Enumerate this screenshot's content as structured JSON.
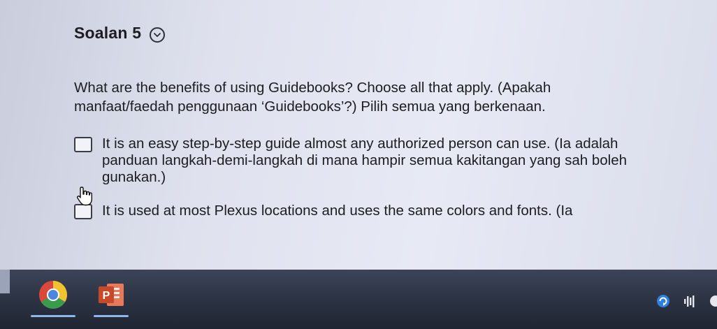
{
  "question": {
    "title": "Soalan 5",
    "prompt": "What are the benefits of using Guidebooks? Choose all that apply. (Apakah manfaat/faedah penggunaan ‘Guidebooks’?) Pilih semua yang berkenaan.",
    "options": [
      {
        "text": "It is an easy step-by-step guide almost any authorized person can use. (Ia adalah panduan langkah-demi-langkah di mana hampir semua kakitangan yang sah boleh gunakan.)",
        "checked": false
      },
      {
        "text": "It is used at most Plexus locations and uses the same colors and fonts. (Ia",
        "checked": false
      }
    ]
  },
  "taskbar": {
    "apps": [
      {
        "icon": "chrome-icon",
        "active": true
      },
      {
        "icon": "powerpoint-icon",
        "active": true,
        "glyph": "P"
      }
    ],
    "tray": [
      "sync-icon",
      "volume-icon",
      "tray-icon"
    ]
  },
  "colors": {
    "background": "#dfe2ee",
    "taskbar": "#2f3748",
    "active_indicator": "#8fb6e8",
    "powerpoint": "#c8482a"
  }
}
